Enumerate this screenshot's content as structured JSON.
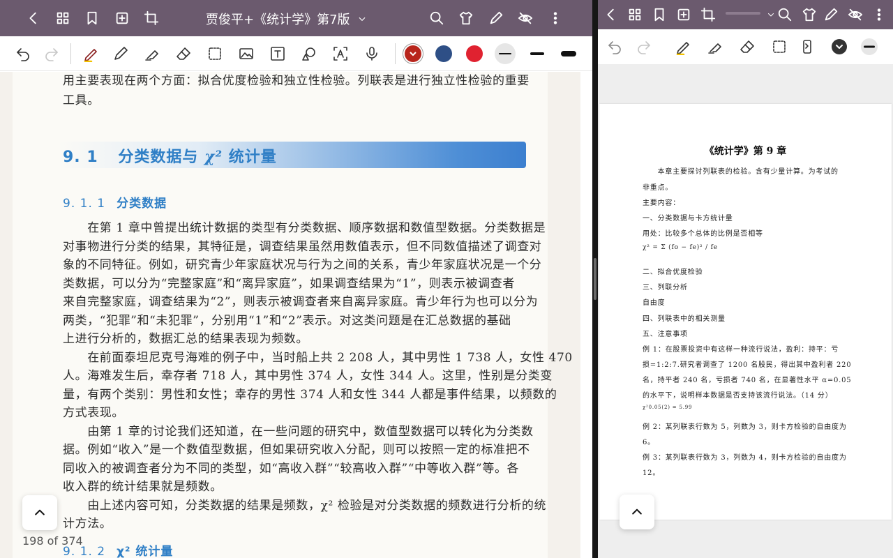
{
  "left": {
    "doc_title": "贾俊平+《统计学》第7版",
    "page_counter": "198 of 374",
    "colors": {
      "topbar": "#6b5a6e",
      "accent": "#2f7fc6",
      "red_swatch": "#b8251c",
      "blue_swatch": "#2e4f86",
      "bright_red_swatch": "#e02230"
    },
    "icons": [
      "back-icon",
      "grid-icon",
      "bookmark-icon",
      "add-page-icon",
      "crop-icon",
      "search-icon",
      "shirt-icon",
      "pen-icon",
      "eye-off-icon",
      "more-icon"
    ],
    "toolbar_icons": [
      "undo-icon",
      "redo-icon",
      "pen-tool-icon",
      "pencil-icon",
      "highlighter-icon",
      "eraser-icon",
      "lasso-select-icon",
      "image-icon",
      "text-box-icon",
      "shape-icon",
      "ocr-icon",
      "microphone-icon"
    ],
    "content": {
      "intro_lines": [
        "用主要表现在两个方面：拟合优度检验和独立性检验。列联表是进行独立性检验的重要",
        "工具。"
      ],
      "section_number": "9. 1",
      "section_title": "分类数据与",
      "section_chi": "χ²",
      "section_title_tail": "统计量",
      "subsection_number": "9. 1. 1",
      "subsection_title": "分类数据",
      "para_lines": [
        "　　在第 1 章中曾提出统计数据的类型有分类数据、顺序数据和数值型数据。分类数据是",
        "对事物进行分类的结果，其特征是，调查结果虽然用数值表示，但不同数值描述了调查对",
        "象的不同特征。例如，研究青少年家庭状况与行为之间的关系，青少年家庭状况是一个分",
        "类数据，可以分为“完整家庭”和“离异家庭”，如果调查结果为“1”，则表示被调查者",
        "来自完整家庭，调查结果为“2”，则表示被调查者来自离异家庭。青少年行为也可以分为",
        "两类，“犯罪”和“未犯罪”，分别用“1”和“2”表示。对这类问题是在汇总数据的基础",
        "上进行分析的，数据汇总的结果表现为频数。",
        "　　在前面泰坦尼克号海难的例子中，当时船上共 2 208 人，其中男性 1 738 人，女性 470",
        "人。海难发生后，幸存者 718 人，其中男性 374 人，女性 344 人。这里，性别是分类变",
        "量，有两个类别：男性和女性；幸存的男性 374 人和女性 344 人都是事件结果，以频数的",
        "方式表现。",
        "　　由第 1 章的讨论我们还知道，在一些问题的研究中，数值型数据可以转化为分类数",
        "据。例如“收入”是一个数值型数据，但如果研究收入分配，则可以按照一定的标准把不",
        "同收入的被调查者分为不同的类型，如“高收入群”“较高收入群”“中等收入群”等。各",
        "收入群的统计结果就是频数。",
        "　　由上述内容可知，分类数据的结果是频数，χ² 检验是对分类数据的频数进行分析的统",
        "计方法。"
      ],
      "subsection2_number": "9. 1. 2",
      "subsection2_title": "χ² 统计量"
    }
  },
  "right": {
    "icons": [
      "back-icon",
      "grid-icon",
      "bookmark-icon",
      "add-page-icon",
      "crop-icon",
      "search-icon",
      "shirt-icon",
      "pen-icon",
      "eye-off-icon",
      "more-icon"
    ],
    "toolbar_icons": [
      "undo-icon",
      "redo-icon",
      "pen-tool-icon",
      "highlighter-icon",
      "eraser-icon",
      "lasso-select-icon",
      "phone-icon"
    ],
    "note": {
      "title": "《统计学》第 9 章",
      "lines": [
        "　　本章主要探讨列联表的检验。含有少量计算。为考试的",
        "非重点。",
        "主要内容：",
        "一、分类数据与卡方统计量",
        "用处：比较多个总体的比例是否相等",
        "χ² = Σ (fo − fe)² / fe",
        "二、拟合优度检验",
        "三、列联分析",
        "自由度",
        "四、列联表中的相关测量",
        "五、注意事项",
        "例 1：在股票投资中有这样一种流行说法，盈利：持平：亏",
        "损=1:2:7.研究者调查了 1200 名股民，得出其中盈利者 220",
        "名，持平者 240 名，亏损者 740 名，在显著性水平 α=0.05",
        "的水平下，说明样本数据是否支持该流行说法。（14 分）",
        "χ²0.05(2) = 5.99",
        "例 2：某列联表行数为 5，列数为 3，则卡方检验的自由度为",
        "6。",
        "例 3：某列联表行数为 3，列数为 4，则卡方检验的自由度为",
        "12。"
      ]
    }
  }
}
